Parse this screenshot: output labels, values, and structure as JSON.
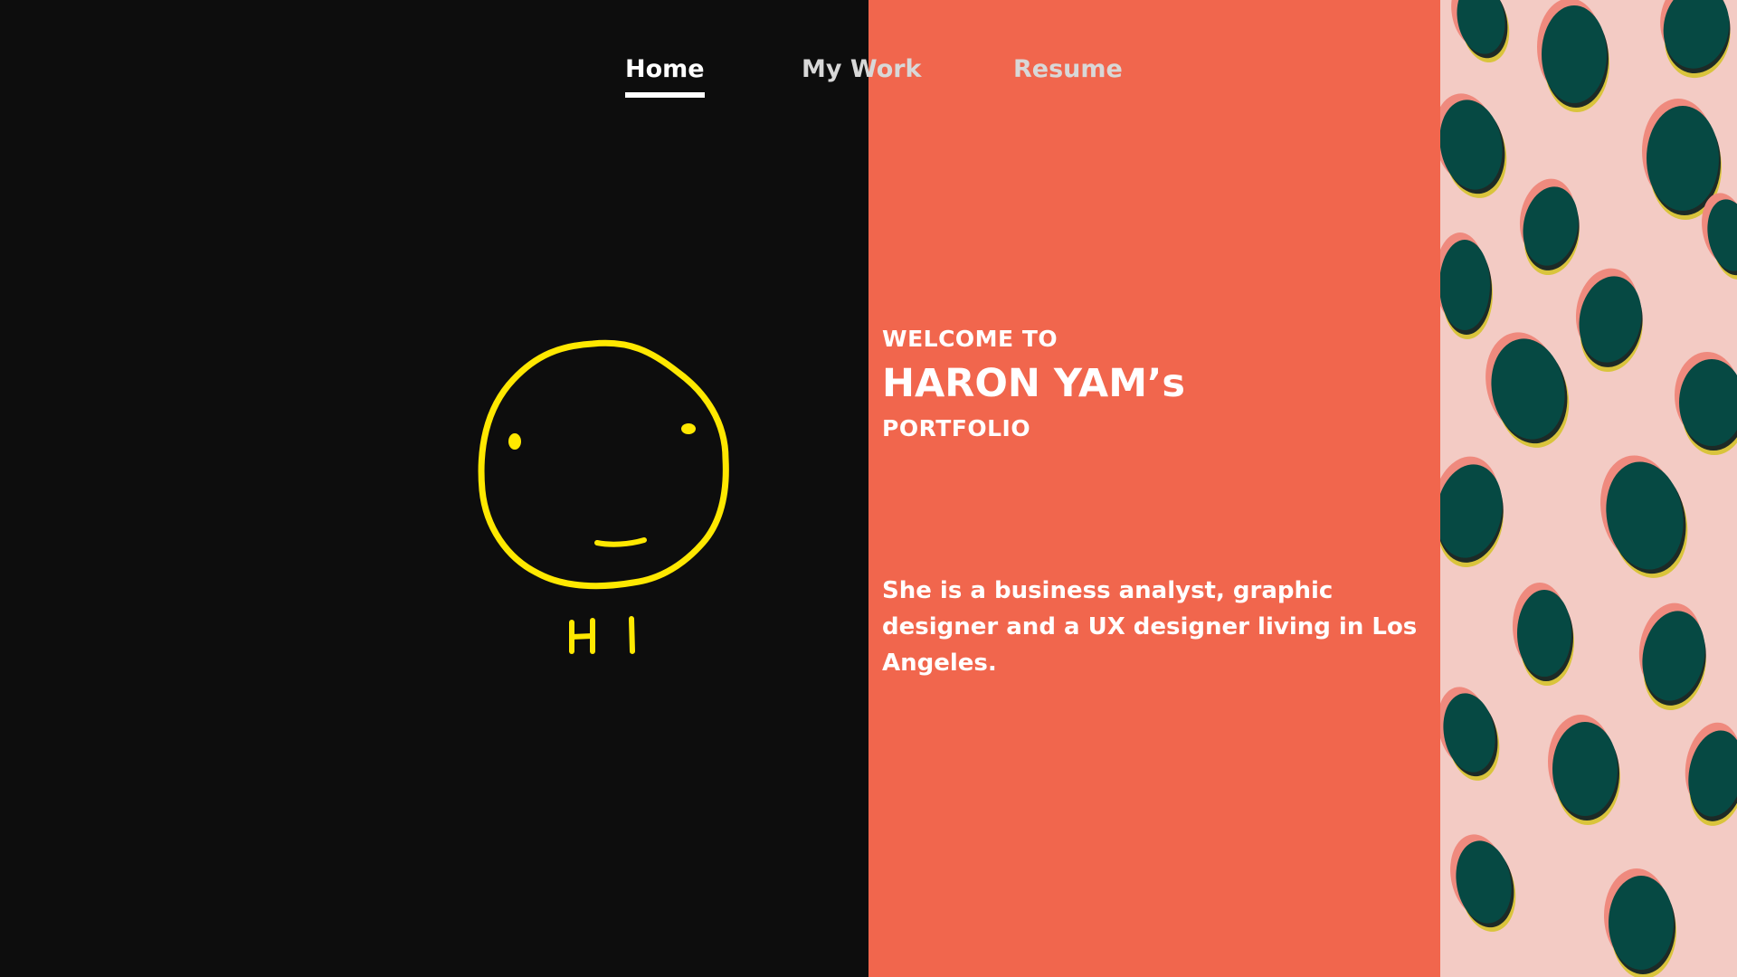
{
  "nav": {
    "items": [
      {
        "label": "Home",
        "active": true
      },
      {
        "label": "My Work",
        "active": false
      },
      {
        "label": "Resume",
        "active": false
      }
    ]
  },
  "hero": {
    "illustration": "smiley-face-drawing",
    "illustration_text": "HI",
    "illustration_color": "#ffe800"
  },
  "welcome": {
    "line1": "WELCOME TO",
    "line2": "HARON YAM’s",
    "line3": "PORTFOLIO"
  },
  "bio": "She is a business analyst, graphic designer and a UX designer living in Los Angeles.",
  "colors": {
    "left_bg": "#0d0d0d",
    "mid_bg": "#f1664d",
    "pattern_bg": "#f3cbc4",
    "pattern_dot": "#064943",
    "pattern_shadow_yellow": "#d9c43c",
    "pattern_shadow_pink": "#ef8a7e"
  }
}
